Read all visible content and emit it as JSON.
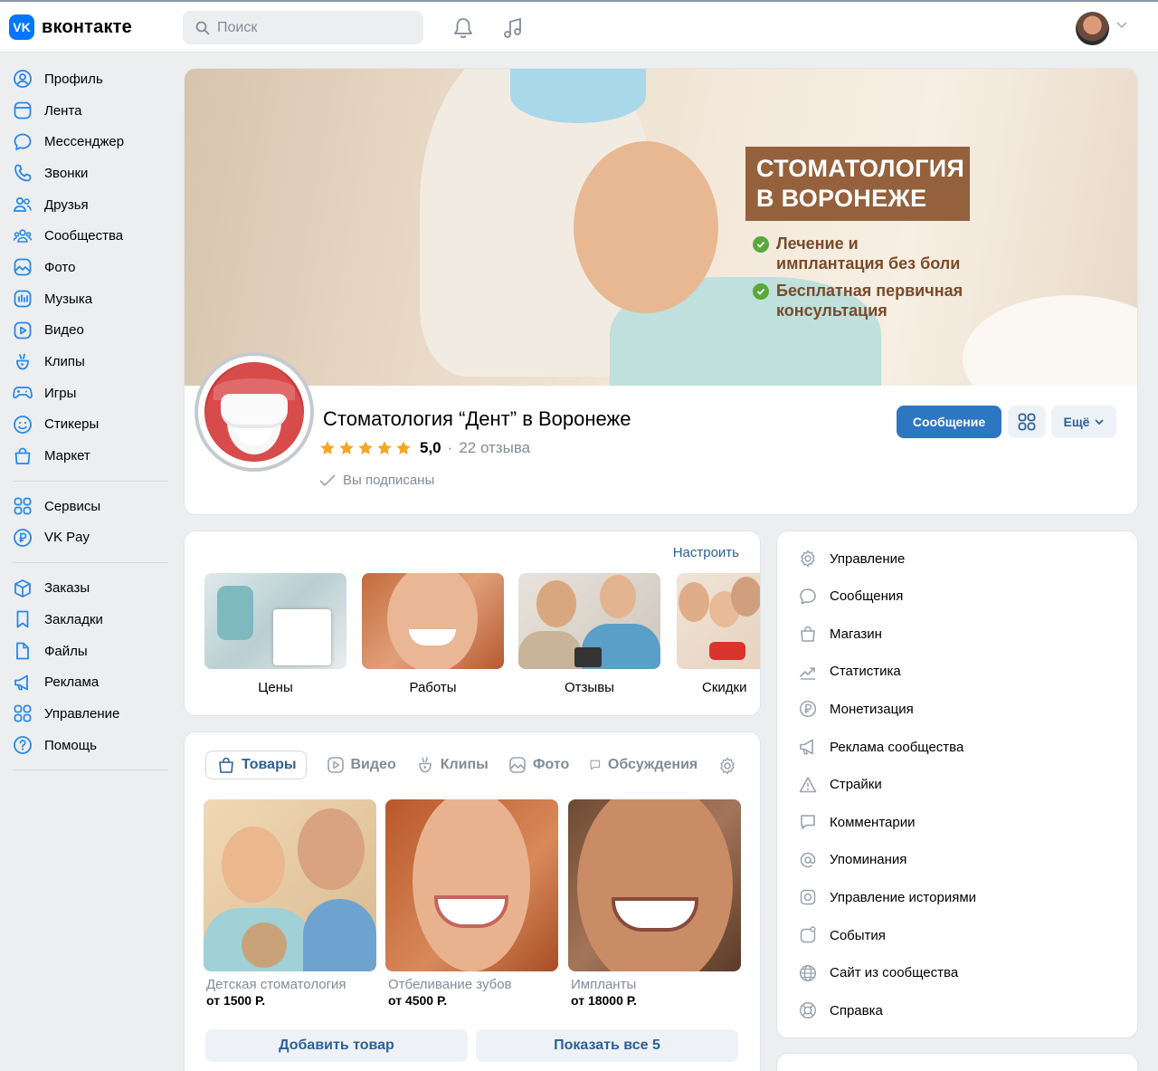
{
  "header": {
    "logo_badge": "VK",
    "logo_text": "вконтакте",
    "search_placeholder": "Поиск",
    "icons": [
      "bell-icon",
      "music-note-icon",
      "chevron-down-icon"
    ]
  },
  "sidebar": {
    "group1": [
      {
        "label": "Профиль",
        "icon": "profile-icon"
      },
      {
        "label": "Лента",
        "icon": "feed-icon"
      },
      {
        "label": "Мессенджер",
        "icon": "chat-icon"
      },
      {
        "label": "Звонки",
        "icon": "phone-icon"
      },
      {
        "label": "Друзья",
        "icon": "friends-icon"
      },
      {
        "label": "Сообщества",
        "icon": "communities-icon"
      },
      {
        "label": "Фото",
        "icon": "photo-icon"
      },
      {
        "label": "Музыка",
        "icon": "music-icon"
      },
      {
        "label": "Видео",
        "icon": "video-icon"
      },
      {
        "label": "Клипы",
        "icon": "clips-icon"
      },
      {
        "label": "Игры",
        "icon": "games-icon"
      },
      {
        "label": "Стикеры",
        "icon": "stickers-icon"
      },
      {
        "label": "Маркет",
        "icon": "market-icon"
      }
    ],
    "group2": [
      {
        "label": "Сервисы",
        "icon": "services-icon"
      },
      {
        "label": "VK Pay",
        "icon": "vkpay-icon"
      }
    ],
    "group3": [
      {
        "label": "Заказы",
        "icon": "orders-icon"
      },
      {
        "label": "Закладки",
        "icon": "bookmark-icon"
      },
      {
        "label": "Файлы",
        "icon": "file-icon"
      },
      {
        "label": "Реклама",
        "icon": "megaphone-icon"
      },
      {
        "label": "Управление",
        "icon": "grid-icon"
      },
      {
        "label": "Помощь",
        "icon": "help-icon"
      }
    ]
  },
  "cover": {
    "title": "СТОМАТОЛОГИЯ В ВОРОНЕЖЕ",
    "bullets": [
      "Лечение и имплантация без боли",
      "Бесплатная первичная консультация"
    ]
  },
  "group": {
    "name": "Стоматология “Дент” в Воронеже",
    "rating": "5,0",
    "stars": 5,
    "reviews": "22 отзыва",
    "subscribed": "Вы подписаны",
    "message_button": "Сообщение",
    "more_button": "Ещё"
  },
  "albums": {
    "configure": "Настроить",
    "items": [
      "Цены",
      "Работы",
      "Отзывы",
      "Скидки"
    ]
  },
  "tabs": [
    {
      "label": "Товары",
      "icon": "bag-icon"
    },
    {
      "label": "Видео",
      "icon": "video-icon"
    },
    {
      "label": "Клипы",
      "icon": "clips-icon"
    },
    {
      "label": "Фото",
      "icon": "photo-icon"
    },
    {
      "label": "Обсуждения",
      "icon": "comment-icon"
    }
  ],
  "products": [
    {
      "title": "Детская стоматология",
      "price": "от 1500 Р."
    },
    {
      "title": "Отбеливание зубов",
      "price": "от 4500 Р."
    },
    {
      "title": "Импланты",
      "price": "от 18000 Р."
    }
  ],
  "goods_buttons": {
    "add": "Добавить товар",
    "show_all": "Показать все 5"
  },
  "manage": [
    {
      "label": "Управление",
      "icon": "gear-icon"
    },
    {
      "label": "Сообщения",
      "icon": "chat-icon"
    },
    {
      "label": "Магазин",
      "icon": "bag-icon"
    },
    {
      "label": "Статистика",
      "icon": "trend-icon"
    },
    {
      "label": "Монетизация",
      "icon": "ruble-icon"
    },
    {
      "label": "Реклама сообщества",
      "icon": "megaphone-icon"
    },
    {
      "label": "Страйки",
      "icon": "warning-icon"
    },
    {
      "label": "Комментарии",
      "icon": "comment-icon"
    },
    {
      "label": "Упоминания",
      "icon": "at-icon"
    },
    {
      "label": "Управление историями",
      "icon": "stories-icon"
    },
    {
      "label": "События",
      "icon": "calendar-icon"
    },
    {
      "label": "Сайт из сообщества",
      "icon": "globe-icon"
    },
    {
      "label": "Справка",
      "icon": "lifebuoy-icon"
    }
  ],
  "colors": {
    "accent": "#2d76c2",
    "link": "#2d5f99",
    "secondary_text": "#818c99",
    "background": "#edeef0"
  }
}
